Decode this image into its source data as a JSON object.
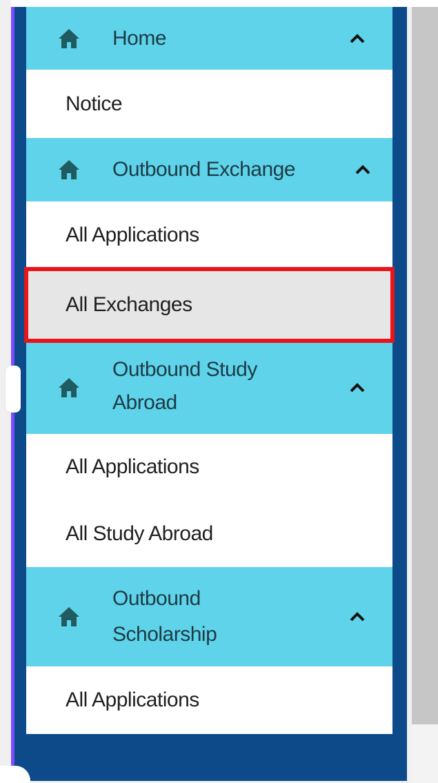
{
  "menu": {
    "groups": [
      {
        "title": "Home",
        "icon": "home-icon",
        "toggle_icon": "chevron-up-icon",
        "items": [
          "Notice"
        ]
      },
      {
        "title": "Outbound Exchange",
        "icon": "home-icon",
        "toggle_icon": "chevron-up-icon",
        "items": [
          "All Applications",
          "All Exchanges"
        ]
      },
      {
        "title_line1": "Outbound Study",
        "title_line2": "Abroad",
        "icon": "home-icon",
        "toggle_icon": "chevron-up-icon",
        "items": [
          "All Applications",
          "All Study Abroad"
        ]
      },
      {
        "title_line1": "Outbound",
        "title_line2": "Scholarship",
        "icon": "home-icon",
        "toggle_icon": "chevron-up-icon",
        "items": [
          "All Applications"
        ]
      }
    ],
    "selected_item": "All Exchanges"
  },
  "colors": {
    "sidebar_bg": "#0d4a8a",
    "header_bg": "#5fd3ea",
    "header_text": "#1d3b45",
    "item_bg": "#ffffff",
    "selected_bg": "#e6e6e6",
    "highlight_border": "#e8141c",
    "sidebar_left_border": "#7c4dff"
  }
}
